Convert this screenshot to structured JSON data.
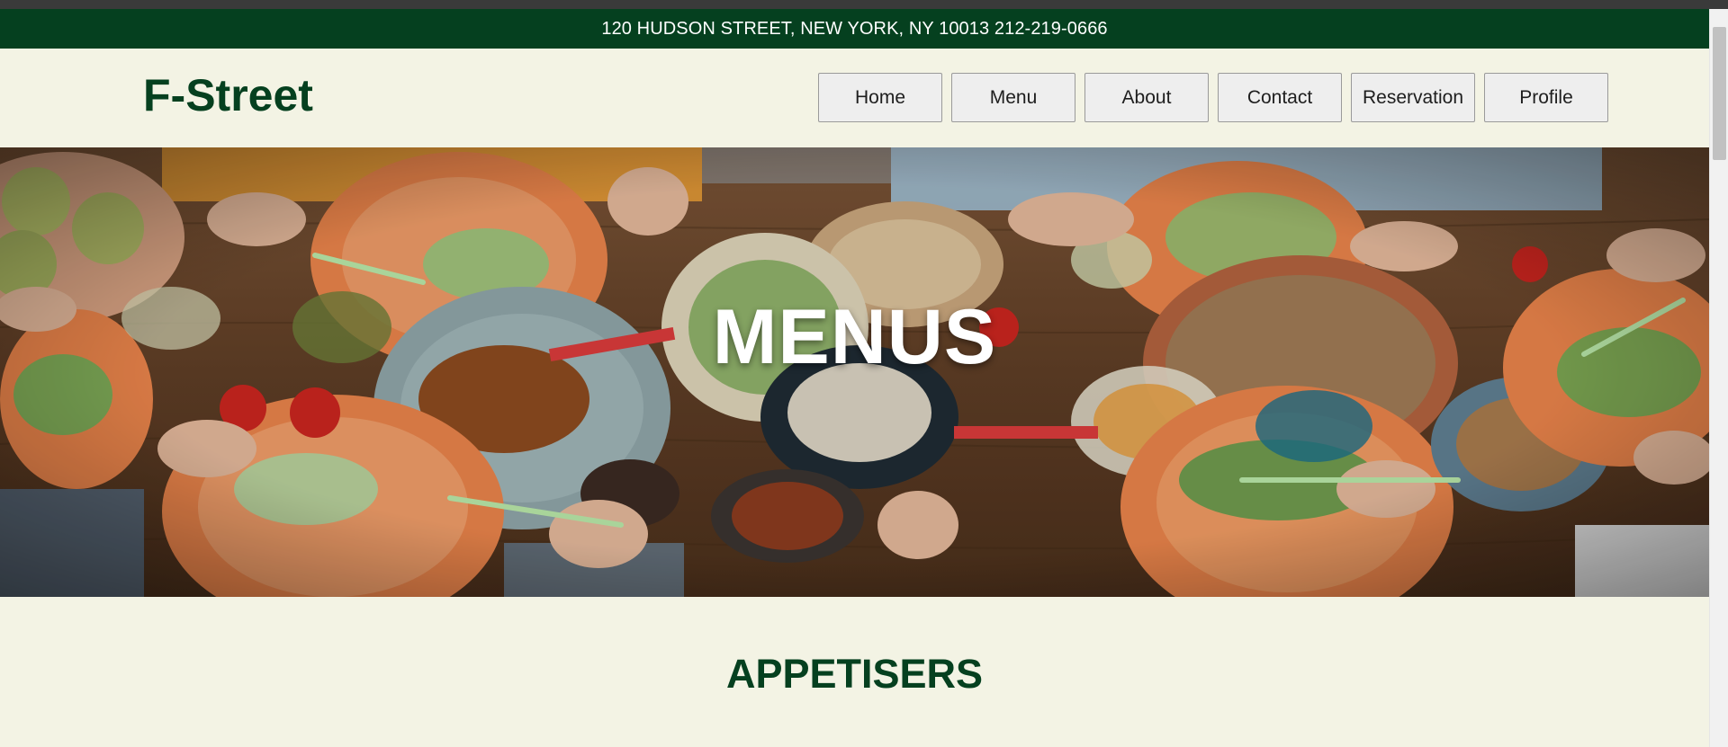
{
  "topbar": {
    "text": "120 HUDSON STREET, NEW YORK, NY 10013 212-219-0666"
  },
  "header": {
    "logo": "F-Street",
    "nav": [
      "Home",
      "Menu",
      "About",
      "Contact",
      "Reservation",
      "Profile"
    ]
  },
  "hero": {
    "title": "MENUS"
  },
  "section": {
    "title": "APPETISERS"
  },
  "colors": {
    "brand_green": "#05401f",
    "page_bg": "#f3f3e4",
    "plate_orange": "#e8834a"
  }
}
